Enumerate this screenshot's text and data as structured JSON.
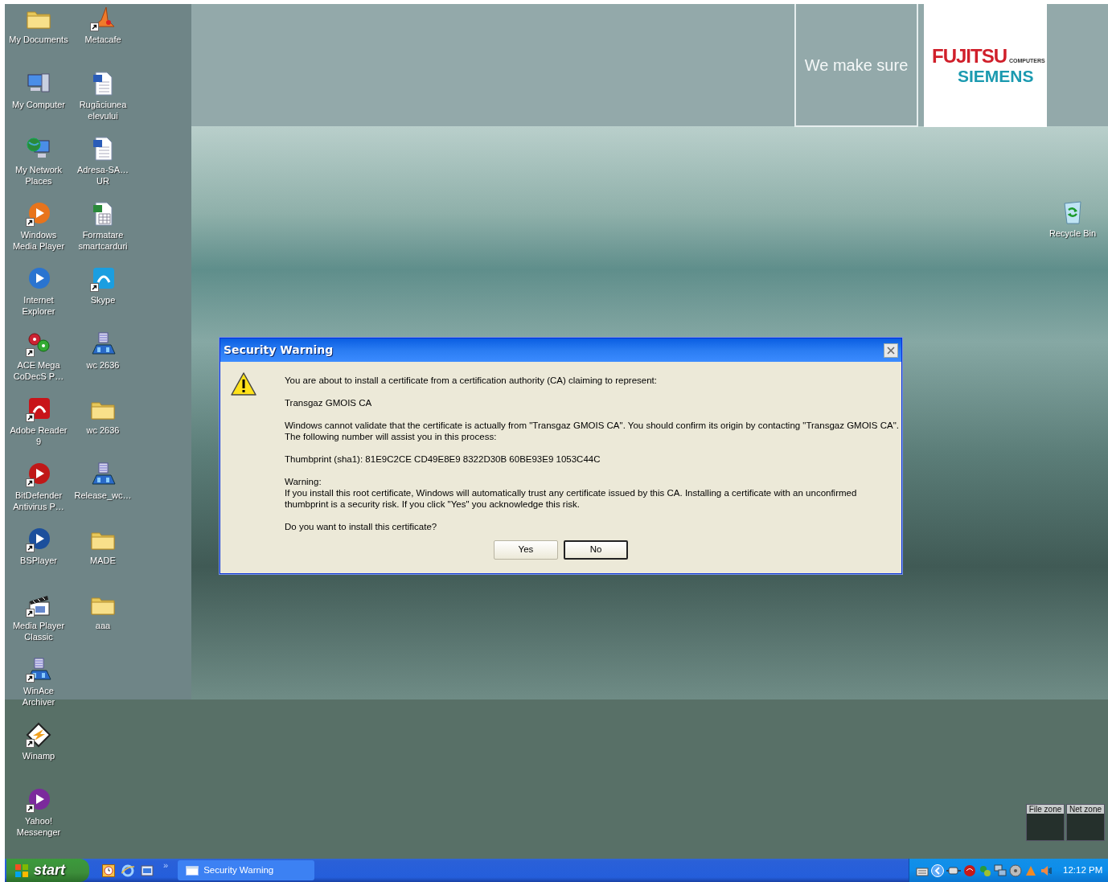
{
  "wallpaper": {
    "tagline": "We make sure",
    "logo": {
      "name": "FUJITSU",
      "sub": "COMPUTERS",
      "brand": "SIEMENS"
    }
  },
  "desktop_icons": [
    {
      "label": "My Documents",
      "kind": "folder",
      "shortcut": false
    },
    {
      "label": "My Computer",
      "kind": "computer",
      "shortcut": false
    },
    {
      "label": "My Network Places",
      "kind": "network",
      "shortcut": false
    },
    {
      "label": "Windows Media Player",
      "kind": "round",
      "color": "#e8741c",
      "shortcut": true
    },
    {
      "label": "Internet Explorer",
      "kind": "round",
      "color": "#2a74d0",
      "shortcut": false
    },
    {
      "label": "ACE Mega CoDecS P…",
      "kind": "gears",
      "shortcut": true
    },
    {
      "label": "Adobe Reader 9",
      "kind": "square",
      "color": "#c8141a",
      "shortcut": true
    },
    {
      "label": "BitDefender Antivirus P…",
      "kind": "round",
      "color": "#c01818",
      "shortcut": true
    },
    {
      "label": "BSPlayer",
      "kind": "round",
      "color": "#1c4f9c",
      "shortcut": true
    },
    {
      "label": "Media Player Classic",
      "kind": "clapper",
      "shortcut": true
    },
    {
      "label": "WinAce Archiver",
      "kind": "tower",
      "shortcut": true
    },
    {
      "label": "Winamp",
      "kind": "diamond",
      "shortcut": true
    },
    {
      "label": "Yahoo! Messenger",
      "kind": "round",
      "color": "#7b2a9c",
      "shortcut": true
    },
    {
      "label": "Metacafe",
      "kind": "flame",
      "shortcut": true
    },
    {
      "label": "Rugăciunea elevului",
      "kind": "document",
      "shortcut": false
    },
    {
      "label": "Adresa-SA… UR",
      "kind": "document",
      "shortcut": false
    },
    {
      "label": "Formatare smartcarduri",
      "kind": "spreadsheet",
      "shortcut": false
    },
    {
      "label": "Skype",
      "kind": "square",
      "color": "#1b9ee0",
      "shortcut": true
    },
    {
      "label": "wc 2636",
      "kind": "tower",
      "shortcut": false
    },
    {
      "label": "wc 2636",
      "kind": "folder",
      "shortcut": false
    },
    {
      "label": "Release_wc…",
      "kind": "tower",
      "shortcut": false
    },
    {
      "label": "MADE",
      "kind": "folder",
      "shortcut": false
    },
    {
      "label": "aaa",
      "kind": "folder",
      "shortcut": false
    }
  ],
  "recycle_bin": {
    "label": "Recycle Bin"
  },
  "dialog": {
    "title": "Security Warning",
    "paragraphs": [
      {
        "lines": [
          "You are about to install a certificate from a certification authority (CA) claiming to represent:"
        ]
      },
      {
        "lines": [
          "Transgaz GMOIS CA"
        ]
      },
      {
        "lines": [
          "Windows cannot validate that the certificate is actually from \"Transgaz GMOIS CA\". You should confirm its origin by contacting \"Transgaz GMOIS CA\".",
          "The following number will assist you in this process:"
        ]
      },
      {
        "lines": [
          "Thumbprint (sha1): 81E9C2CE CD49E8E9 8322D30B 60BE93E9 1053C44C"
        ]
      },
      {
        "lines": [
          "Warning:",
          "If you install this root certificate, Windows will automatically trust any certificate issued by this CA. Installing a certificate with an unconfirmed",
          "thumbprint is a security risk. If you click \"Yes\" you acknowledge this risk."
        ]
      },
      {
        "lines": [
          "Do you want to install this certificate?"
        ]
      }
    ],
    "buttons": [
      {
        "label": "Yes",
        "default": false
      },
      {
        "label": "No",
        "default": true
      }
    ]
  },
  "zone_monitor": [
    {
      "label": "File zone"
    },
    {
      "label": "Net zone"
    }
  ],
  "taskbar": {
    "start": "start",
    "quick_launch_more": "»",
    "tasks": [
      {
        "label": "Security Warning",
        "selected": false
      }
    ],
    "clock": "12:12 PM"
  }
}
